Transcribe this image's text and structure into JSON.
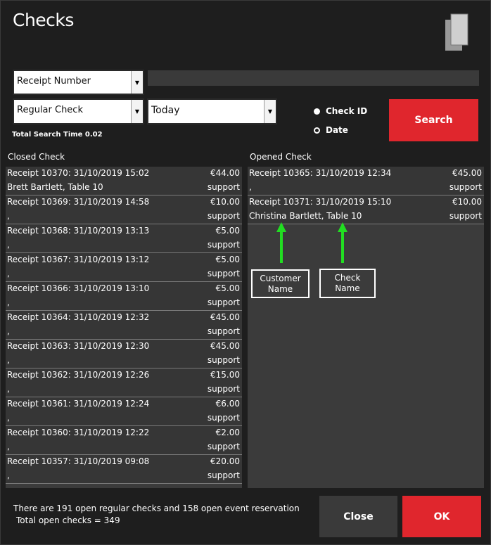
{
  "window": {
    "title": "Checks"
  },
  "search": {
    "filter_type": "Receipt Number",
    "check_type": "Regular Check",
    "date_range": "Today",
    "query": "",
    "radio_check_id": "Check ID",
    "radio_date": "Date",
    "search_label": "Search",
    "total_time": "Total Search Time 0.02"
  },
  "closed": {
    "label": "Closed Check",
    "rows": [
      {
        "receipt": "Receipt 10370: 31/10/2019 15:02",
        "amount": "€44.00",
        "name": "Brett Bartlett, Table 10",
        "user": "support"
      },
      {
        "receipt": "Receipt 10369: 31/10/2019 14:58",
        "amount": "€10.00",
        "name": ",",
        "user": "support"
      },
      {
        "receipt": "Receipt 10368: 31/10/2019 13:13",
        "amount": "€5.00",
        "name": ",",
        "user": "support"
      },
      {
        "receipt": "Receipt 10367: 31/10/2019 13:12",
        "amount": "€5.00",
        "name": ",",
        "user": "support"
      },
      {
        "receipt": "Receipt 10366: 31/10/2019 13:10",
        "amount": "€5.00",
        "name": ",",
        "user": "support"
      },
      {
        "receipt": "Receipt 10364: 31/10/2019 12:32",
        "amount": "€45.00",
        "name": ",",
        "user": "support"
      },
      {
        "receipt": "Receipt 10363: 31/10/2019 12:30",
        "amount": "€45.00",
        "name": ",",
        "user": "support"
      },
      {
        "receipt": "Receipt 10362: 31/10/2019 12:26",
        "amount": "€15.00",
        "name": ",",
        "user": "support"
      },
      {
        "receipt": "Receipt 10361: 31/10/2019 12:24",
        "amount": "€6.00",
        "name": ",",
        "user": "support"
      },
      {
        "receipt": "Receipt 10360: 31/10/2019 12:22",
        "amount": "€2.00",
        "name": ",",
        "user": "support"
      },
      {
        "receipt": "Receipt 10357: 31/10/2019 09:08",
        "amount": "€20.00",
        "name": ",",
        "user": "support"
      }
    ]
  },
  "opened": {
    "label": "Opened Check",
    "rows": [
      {
        "receipt": "Receipt 10365: 31/10/2019 12:34",
        "amount": "€45.00",
        "name": ",",
        "user": "support"
      },
      {
        "receipt": "Receipt 10371: 31/10/2019 15:10",
        "amount": "€10.00",
        "name": "Christina Bartlett, Table 10",
        "user": "support"
      }
    ]
  },
  "annotations": {
    "customer_name": "Customer\nName",
    "check_name": "Check\nName",
    "arrow_color": "#22dd22"
  },
  "footer": {
    "info_line1": "There are 191 open regular checks and 158 open event reservation",
    "info_line2": "Total open checks = 349",
    "close_label": "Close",
    "ok_label": "OK"
  }
}
